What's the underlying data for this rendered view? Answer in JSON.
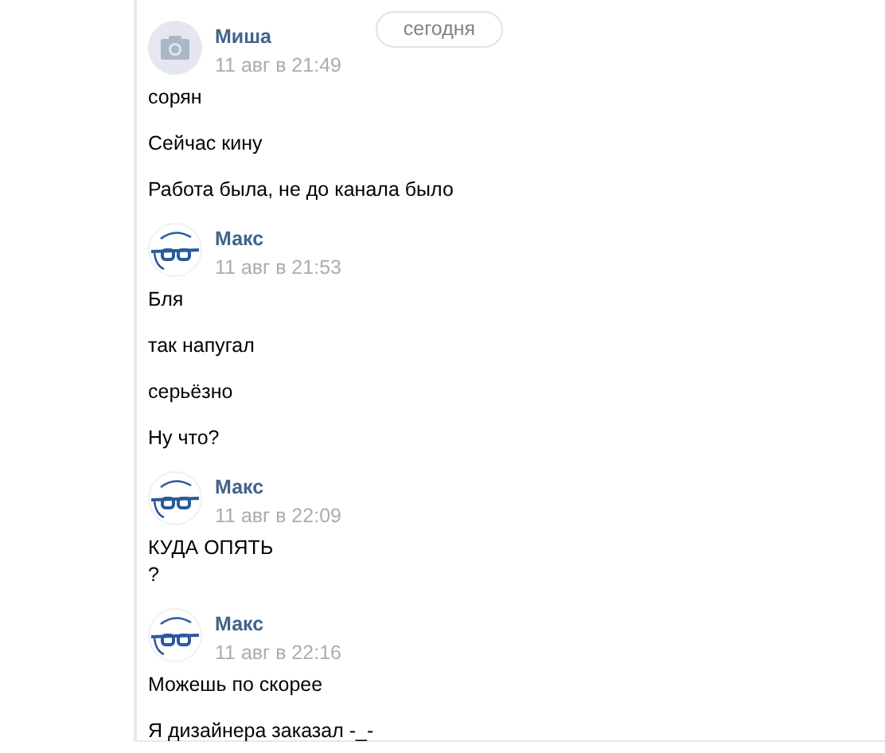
{
  "date_badge": "сегодня",
  "groups": [
    {
      "author": "Миша",
      "kind": "camera",
      "time": "11 авг в 21:49",
      "messages": [
        {
          "lines": [
            "сорян"
          ]
        },
        {
          "lines": [
            "Сейчас кину"
          ]
        },
        {
          "lines": [
            "Работа была, не до канала было"
          ]
        }
      ]
    },
    {
      "author": "Макс",
      "kind": "glasses",
      "time": "11 авг в 21:53",
      "messages": [
        {
          "lines": [
            "Бля"
          ]
        },
        {
          "lines": [
            "так напугал"
          ]
        },
        {
          "lines": [
            "серьёзно"
          ]
        },
        {
          "lines": [
            "Ну что?"
          ]
        }
      ]
    },
    {
      "author": "Макс",
      "kind": "glasses",
      "time": "11 авг в 22:09",
      "messages": [
        {
          "lines": [
            "КУДА ОПЯТЬ",
            "?"
          ]
        }
      ]
    },
    {
      "author": "Макс",
      "kind": "glasses",
      "time": "11 авг в 22:16",
      "messages": [
        {
          "lines": [
            "Можешь по скорее"
          ]
        },
        {
          "lines": [
            "Я дизайнера заказал -_-"
          ]
        }
      ]
    }
  ]
}
